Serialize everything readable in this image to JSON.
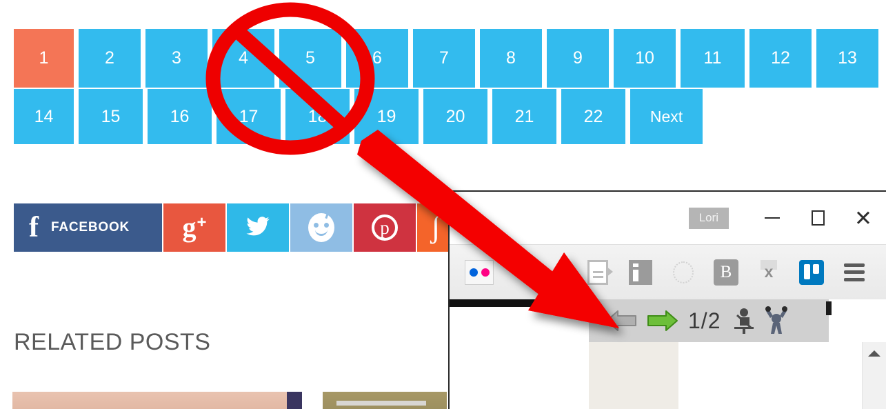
{
  "pagination": {
    "row1": [
      {
        "label": "1",
        "active": true
      },
      {
        "label": "2",
        "active": false
      },
      {
        "label": "3",
        "active": false
      },
      {
        "label": "4",
        "active": false
      },
      {
        "label": "5",
        "active": false
      },
      {
        "label": "6",
        "active": false
      },
      {
        "label": "7",
        "active": false
      },
      {
        "label": "8",
        "active": false
      },
      {
        "label": "9",
        "active": false
      },
      {
        "label": "10",
        "active": false
      },
      {
        "label": "11",
        "active": false
      },
      {
        "label": "12",
        "active": false
      },
      {
        "label": "13",
        "active": false
      }
    ],
    "row2": [
      {
        "label": "14",
        "active": false
      },
      {
        "label": "15",
        "active": false
      },
      {
        "label": "16",
        "active": false
      },
      {
        "label": "17",
        "active": false
      },
      {
        "label": "18",
        "active": false
      },
      {
        "label": "19",
        "active": false
      },
      {
        "label": "20",
        "active": false
      },
      {
        "label": "21",
        "active": false
      },
      {
        "label": "22",
        "active": false
      },
      {
        "label": "Next",
        "active": false
      }
    ],
    "active_color": "#f47556",
    "inactive_color": "#33bbee",
    "text_color": "#ffffff"
  },
  "social": {
    "facebook": {
      "glyph": "f",
      "label": "FACEBOOK",
      "color": "#3b5a8c",
      "icon": "facebook-icon"
    },
    "googleplus": {
      "glyph": "g",
      "plus": "+",
      "color": "#e8573f",
      "icon": "google-plus-icon"
    },
    "twitter": {
      "icon": "twitter-bird-icon",
      "color": "#2fb9e8"
    },
    "reddit": {
      "icon": "reddit-alien-icon",
      "color": "#8fbde4"
    },
    "pinterest": {
      "glyph": "p",
      "icon": "pinterest-icon",
      "color": "#cf3340"
    },
    "stumbleupon": {
      "glyph": "ʃ",
      "icon": "stumbleupon-icon",
      "color": "#f4642a"
    }
  },
  "related": {
    "title": "RELATED POSTS"
  },
  "browser": {
    "titlebar": {
      "user_chip": "Lori",
      "minimize": "—",
      "maximize": "□",
      "close": "✕"
    },
    "toolbar_icons": [
      "flickr-icon",
      "note-export-icon",
      "info-panel-icon",
      "circle-outline-icon",
      "bold-b-icon",
      "cut-x-icon",
      "trello-icon",
      "hamburger-menu-icon"
    ],
    "findbar": {
      "prev_icon": "arrow-left-icon",
      "next_icon": "arrow-right-icon",
      "count": "1/2",
      "figure1_icon": "seated-figure-icon",
      "figure2_icon": "standing-figure-icon"
    },
    "scrollbar": {
      "up_arrow_icon": "scroll-up-arrow-icon"
    }
  },
  "annotations": {
    "no_sign": {
      "icon": "prohibition-sign-icon",
      "color": "#ee0000"
    },
    "arrow": {
      "icon": "red-pointer-arrow-icon",
      "color": "#f40000"
    }
  }
}
